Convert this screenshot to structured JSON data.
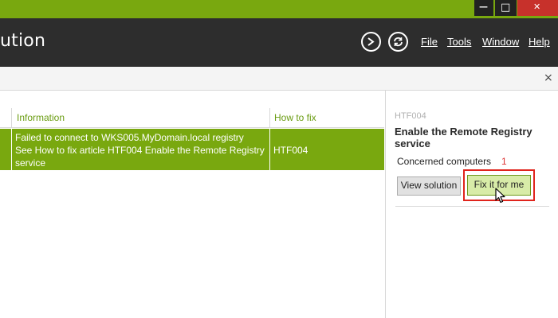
{
  "window": {
    "minimize_glyph": "—",
    "maximize_glyph": "□",
    "close_glyph": "✕"
  },
  "header": {
    "title": "ution",
    "icons": [
      "sigma-icon",
      "refresh-icon"
    ],
    "menu": [
      {
        "label": "File"
      },
      {
        "label": "Tools"
      },
      {
        "label": "Window"
      },
      {
        "label": "Help"
      }
    ]
  },
  "toolbar": {
    "close_glyph": "×"
  },
  "grid": {
    "columns": [
      "Information",
      "How to fix"
    ],
    "rows": [
      {
        "information": [
          "Failed to connect to WKS005.MyDomain.local registry",
          "See How to fix article HTF004 Enable the Remote Registry",
          "service"
        ],
        "how_to_fix": "HTF004"
      }
    ]
  },
  "panel": {
    "code": "HTF004",
    "title": "Enable the Remote Registry service",
    "concerned_label": "Concerned computers",
    "concerned_count": "1",
    "view_solution_label": "View solution",
    "fix_label": "Fix it for me"
  },
  "colors": {
    "accent_green": "#79a80f",
    "header_dark": "#2d2d2d",
    "close_red": "#c7312b",
    "highlight_red": "#e0241c"
  }
}
